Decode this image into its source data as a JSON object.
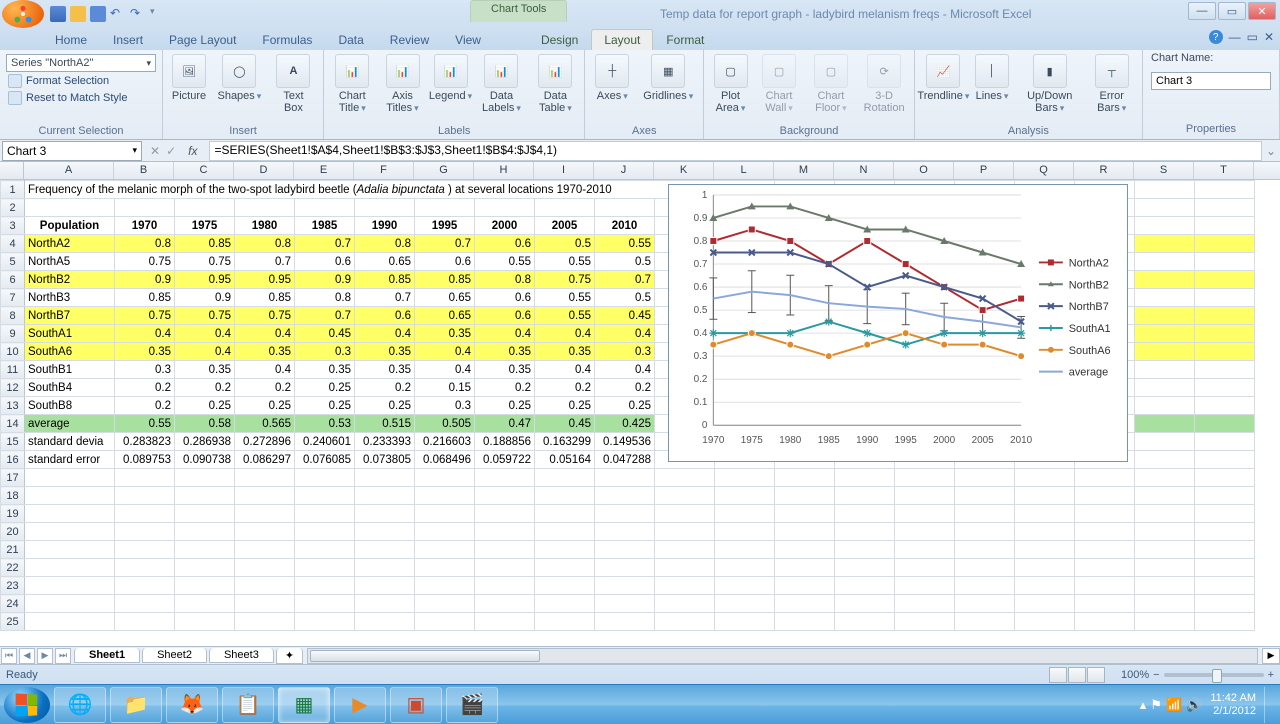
{
  "app": {
    "chart_tools_label": "Chart Tools",
    "title": "Temp data for report graph - ladybird melanism freqs - Microsoft Excel"
  },
  "tabs": {
    "main": [
      "Home",
      "Insert",
      "Page Layout",
      "Formulas",
      "Data",
      "Review",
      "View"
    ],
    "context": [
      "Design",
      "Layout",
      "Format"
    ],
    "active": "Layout"
  },
  "ribbon": {
    "current_selection": {
      "combo": "Series \"NorthA2\"",
      "format_selection": "Format Selection",
      "reset": "Reset to Match Style",
      "group_label": "Current Selection"
    },
    "insert": {
      "items": [
        "Picture",
        "Shapes",
        "Text Box"
      ],
      "group_label": "Insert"
    },
    "labels": {
      "items": [
        "Chart Title",
        "Axis Titles",
        "Legend",
        "Data Labels",
        "Data Table"
      ],
      "group_label": "Labels"
    },
    "axes": {
      "items": [
        "Axes",
        "Gridlines"
      ],
      "group_label": "Axes"
    },
    "background": {
      "items": [
        "Plot Area",
        "Chart Wall",
        "Chart Floor",
        "3-D Rotation"
      ],
      "group_label": "Background"
    },
    "analysis": {
      "items": [
        "Trendline",
        "Lines",
        "Up/Down Bars",
        "Error Bars"
      ],
      "group_label": "Analysis"
    },
    "properties": {
      "name_label": "Chart Name:",
      "name_value": "Chart 3",
      "group_label": "Properties"
    }
  },
  "formula_bar": {
    "namebox": "Chart 3",
    "fx": "fx",
    "formula": "=SERIES(Sheet1!$A$4,Sheet1!$B$3:$J$3,Sheet1!$B$4:$J$4,1)"
  },
  "columns": [
    "A",
    "B",
    "C",
    "D",
    "E",
    "F",
    "G",
    "H",
    "I",
    "J",
    "K",
    "L",
    "M",
    "N",
    "O",
    "P",
    "Q",
    "R",
    "S",
    "T"
  ],
  "sheet": {
    "title_row": "Frequency of the melanic morph of the two-spot ladybird beetle (Adalia bipunctata ) at several locations 1970-2010",
    "title_pre": "Frequency of the melanic morph of the two-spot ladybird beetle (",
    "title_ital": "Adalia bipunctata",
    "title_post": " ) at several locations 1970-2010",
    "headers": [
      "Population",
      "1970",
      "1975",
      "1980",
      "1985",
      "1990",
      "1995",
      "2000",
      "2005",
      "2010"
    ],
    "rows": [
      {
        "label": "NorthA2",
        "hl": true,
        "vals": [
          "0.8",
          "0.85",
          "0.8",
          "0.7",
          "0.8",
          "0.7",
          "0.6",
          "0.5",
          "0.55"
        ]
      },
      {
        "label": "NorthA5",
        "hl": false,
        "vals": [
          "0.75",
          "0.75",
          "0.7",
          "0.6",
          "0.65",
          "0.6",
          "0.55",
          "0.55",
          "0.5"
        ]
      },
      {
        "label": "NorthB2",
        "hl": true,
        "vals": [
          "0.9",
          "0.95",
          "0.95",
          "0.9",
          "0.85",
          "0.85",
          "0.8",
          "0.75",
          "0.7"
        ]
      },
      {
        "label": "NorthB3",
        "hl": false,
        "vals": [
          "0.85",
          "0.9",
          "0.85",
          "0.8",
          "0.7",
          "0.65",
          "0.6",
          "0.55",
          "0.5"
        ]
      },
      {
        "label": "NorthB7",
        "hl": true,
        "vals": [
          "0.75",
          "0.75",
          "0.75",
          "0.7",
          "0.6",
          "0.65",
          "0.6",
          "0.55",
          "0.45"
        ]
      },
      {
        "label": "SouthA1",
        "hl": true,
        "vals": [
          "0.4",
          "0.4",
          "0.4",
          "0.45",
          "0.4",
          "0.35",
          "0.4",
          "0.4",
          "0.4"
        ]
      },
      {
        "label": "SouthA6",
        "hl": true,
        "vals": [
          "0.35",
          "0.4",
          "0.35",
          "0.3",
          "0.35",
          "0.4",
          "0.35",
          "0.35",
          "0.3"
        ]
      },
      {
        "label": "SouthB1",
        "hl": false,
        "vals": [
          "0.3",
          "0.35",
          "0.4",
          "0.35",
          "0.35",
          "0.4",
          "0.35",
          "0.4",
          "0.4"
        ]
      },
      {
        "label": "SouthB4",
        "hl": false,
        "vals": [
          "0.2",
          "0.2",
          "0.2",
          "0.25",
          "0.2",
          "0.15",
          "0.2",
          "0.2",
          "0.2"
        ]
      },
      {
        "label": "SouthB8",
        "hl": false,
        "vals": [
          "0.2",
          "0.25",
          "0.25",
          "0.25",
          "0.25",
          "0.3",
          "0.25",
          "0.25",
          "0.25"
        ]
      }
    ],
    "average": {
      "label": "average",
      "vals": [
        "0.55",
        "0.58",
        "0.565",
        "0.53",
        "0.515",
        "0.505",
        "0.47",
        "0.45",
        "0.425"
      ]
    },
    "stddev": {
      "label": "standard devia",
      "vals": [
        "0.283823",
        "0.286938",
        "0.272896",
        "0.240601",
        "0.233393",
        "0.216603",
        "0.188856",
        "0.163299",
        "0.149536"
      ]
    },
    "stderr": {
      "label": "standard error",
      "vals": [
        "0.089753",
        "0.090738",
        "0.086297",
        "0.076085",
        "0.073805",
        "0.068496",
        "0.059722",
        "0.05164",
        "0.047288"
      ]
    }
  },
  "chart_data": {
    "type": "line",
    "categories": [
      "1970",
      "1975",
      "1980",
      "1985",
      "1990",
      "1995",
      "2000",
      "2005",
      "2010"
    ],
    "ylim": [
      0,
      1
    ],
    "yticks": [
      0,
      0.1,
      0.2,
      0.3,
      0.4,
      0.5,
      0.6,
      0.7,
      0.8,
      0.9,
      1
    ],
    "series": [
      {
        "name": "NorthA2",
        "color": "#b02a30",
        "values": [
          0.8,
          0.85,
          0.8,
          0.7,
          0.8,
          0.7,
          0.6,
          0.5,
          0.55
        ]
      },
      {
        "name": "NorthB2",
        "color": "#6a7a6a",
        "values": [
          0.9,
          0.95,
          0.95,
          0.9,
          0.85,
          0.85,
          0.8,
          0.75,
          0.7
        ]
      },
      {
        "name": "NorthB7",
        "color": "#4a5a8a",
        "values": [
          0.75,
          0.75,
          0.75,
          0.7,
          0.6,
          0.65,
          0.6,
          0.55,
          0.45
        ]
      },
      {
        "name": "SouthA1",
        "color": "#2a9aa0",
        "values": [
          0.4,
          0.4,
          0.4,
          0.45,
          0.4,
          0.35,
          0.4,
          0.4,
          0.4
        ]
      },
      {
        "name": "SouthA6",
        "color": "#e08a2a",
        "values": [
          0.35,
          0.4,
          0.35,
          0.3,
          0.35,
          0.4,
          0.35,
          0.35,
          0.3
        ]
      },
      {
        "name": "average",
        "color": "#8aa8d8",
        "values": [
          0.55,
          0.58,
          0.565,
          0.53,
          0.515,
          0.505,
          0.47,
          0.45,
          0.425
        ]
      }
    ],
    "error_bars_series": "average",
    "error_bars_values": [
      0.089753,
      0.090738,
      0.086297,
      0.076085,
      0.073805,
      0.068496,
      0.059722,
      0.05164,
      0.047288
    ]
  },
  "sheet_tabs": [
    "Sheet1",
    "Sheet2",
    "Sheet3"
  ],
  "status": {
    "ready": "Ready",
    "zoom": "100%"
  },
  "taskbar": {
    "time": "11:42 AM",
    "date": "2/1/2012"
  }
}
